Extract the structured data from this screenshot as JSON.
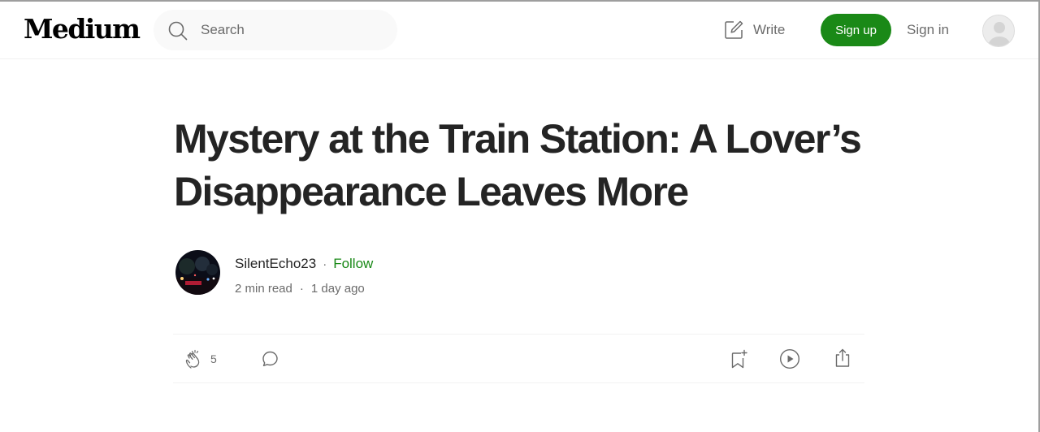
{
  "header": {
    "logo": "Medium",
    "search_placeholder": "Search",
    "write_label": "Write",
    "signup_label": "Sign up",
    "signin_label": "Sign in"
  },
  "article": {
    "title": "Mystery at the Train Station: A Lover’s Disappearance Leaves More",
    "author": "SilentEcho23",
    "separator": "·",
    "follow_label": "Follow",
    "read_time": "2 min read",
    "published": "1 day ago"
  },
  "actions": {
    "clap_count": "5"
  },
  "icons": {
    "search": "search-icon",
    "write": "write-icon",
    "user": "user-avatar-icon",
    "clap": "clap-icon",
    "comment": "comment-icon",
    "save": "bookmark-add-icon",
    "listen": "play-icon",
    "share": "share-icon"
  },
  "colors": {
    "accent": "#1a8917",
    "text": "#242424",
    "muted": "#6b6b6b"
  }
}
